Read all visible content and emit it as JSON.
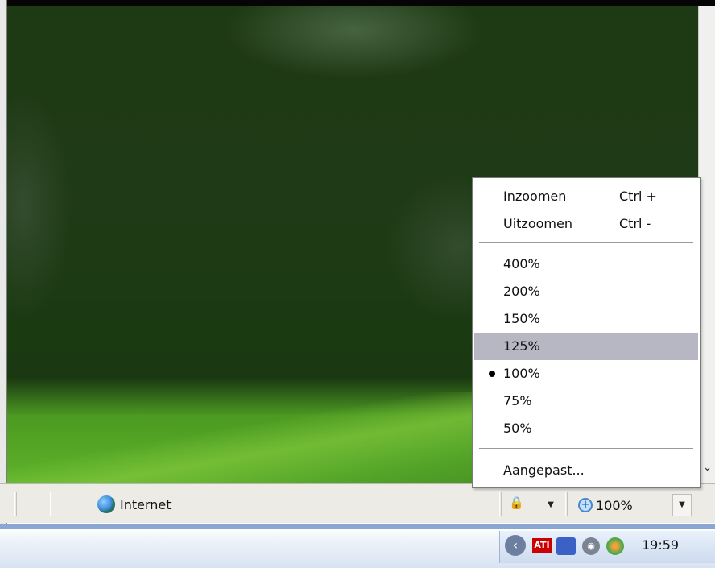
{
  "status_bar": {
    "zone_label": "Internet",
    "zoom_level": "100%"
  },
  "zoom_menu": {
    "commands": [
      {
        "label": "Inzoomen",
        "shortcut": "Ctrl +"
      },
      {
        "label": "Uitzoomen",
        "shortcut": "Ctrl -"
      }
    ],
    "levels": [
      {
        "label": "400%"
      },
      {
        "label": "200%"
      },
      {
        "label": "150%"
      },
      {
        "label": "125%"
      },
      {
        "label": "100%"
      },
      {
        "label": "75%"
      },
      {
        "label": "50%"
      }
    ],
    "highlighted_level": "125%",
    "selected_level": "100%",
    "custom_label": "Aangepast..."
  },
  "taskbar": {
    "tray_ati_label": "ATI",
    "clock": "19:59"
  },
  "icons": {
    "zone": "globe-icon",
    "zoom": "magnifier-plus-icon",
    "protected_mode": "lock-icon",
    "tray_expand": "chevron-left-icon",
    "tray_network": "network-icon",
    "tray_volume": "speaker-icon",
    "tray_security": "security-shield-icon"
  },
  "colors": {
    "menu_highlight": "#b7b6c3",
    "statusbar_bg": "#ecebe6",
    "taskbar_bg": "#d8e3f2"
  }
}
